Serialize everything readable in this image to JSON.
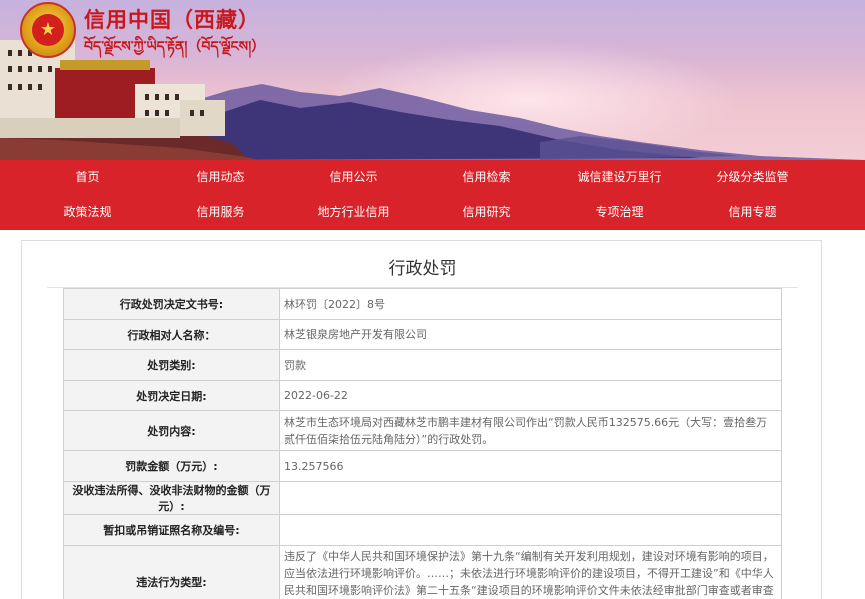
{
  "header": {
    "emblem_glyph": "★",
    "site_title": "信用中国（西藏）",
    "site_subtitle": "བོད་ལྗོངས་ཀྱི་ཡིད་རྟོན།（བོད་ལྗོངས།）"
  },
  "nav": {
    "row1": [
      "首页",
      "信用动态",
      "信用公示",
      "信用检索",
      "诚信建设万里行",
      "分级分类监管"
    ],
    "row2": [
      "政策法规",
      "信用服务",
      "地方行业信用",
      "信用研究",
      "专项治理",
      "信用专题"
    ]
  },
  "page": {
    "title": "行政处罚"
  },
  "record": {
    "rows": [
      {
        "label": "行政处罚决定文书号:",
        "value": "林环罚〔2022〕8号"
      },
      {
        "label": "行政相对人名称：",
        "value": "林芝银泉房地产开发有限公司"
      },
      {
        "label": "处罚类别:",
        "value": "罚款"
      },
      {
        "label": "处罚决定日期:",
        "value": "2022-06-22"
      },
      {
        "label": "处罚内容:",
        "value": "林芝市生态环境局对西藏林芝市鹏丰建材有限公司作出“罚款人民币132575.66元（大写：壹拾叁万贰仟伍佰柒拾伍元陆角陆分）”的行政处罚。"
      },
      {
        "label": "罚款金额（万元）:",
        "value": "13.257566"
      },
      {
        "label": "没收违法所得、没收非法财物的金额（万元）:",
        "value": ""
      },
      {
        "label": "暂扣或吊销证照名称及编号:",
        "value": ""
      },
      {
        "label": "违法行为类型:",
        "value": "违反了《中华人民共和国环境保护法》第十九条“编制有关开发利用规划，建设对环境有影响的项目，应当依法进行环境影响评价。……；未依法进行环境影响评价的建设项目，不得开工建设”和《中华人民共和国环境影响评价法》第二十五条“建设项目的环境影响评价文件未依法经审批部门审查或者审查后未予批准的，建设单位不得开工建设”的规定。"
      }
    ]
  },
  "colors": {
    "brand_red": "#d8232a",
    "title_red": "#c9171e"
  }
}
